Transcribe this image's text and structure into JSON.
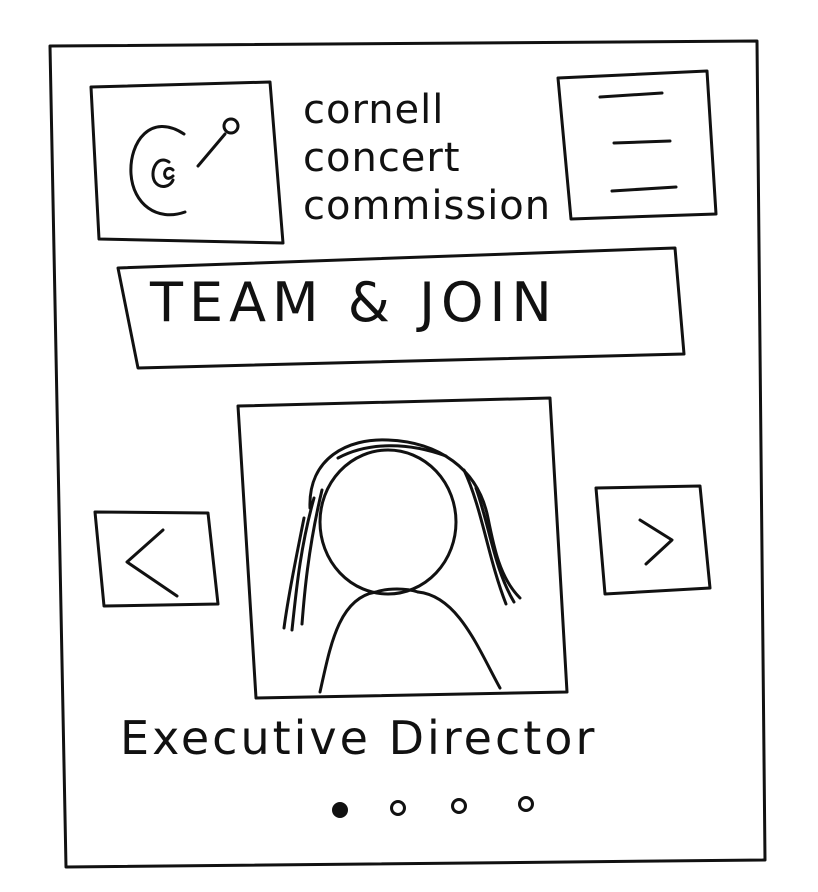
{
  "header": {
    "brand_lines": [
      "cornell",
      "concert",
      "commission"
    ],
    "logo_icon": "cc-logo-icon",
    "menu_icon": "hamburger-icon"
  },
  "banner": {
    "title": "TEAM & JOIN"
  },
  "carousel": {
    "prev_icon": "chevron-left-icon",
    "next_icon": "chevron-right-icon",
    "photo_icon": "person-portrait-icon",
    "caption": "Executive Director",
    "slide_count": 4,
    "active_index": 0
  }
}
